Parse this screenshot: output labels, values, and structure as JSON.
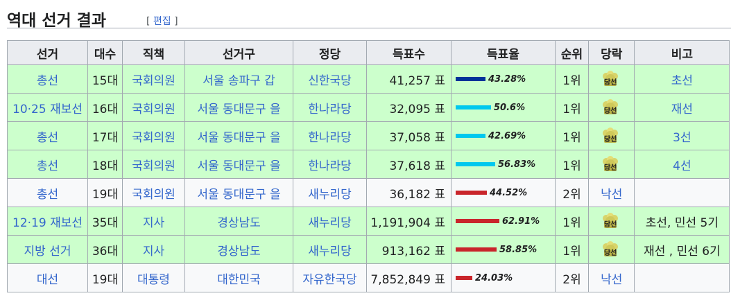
{
  "section": {
    "title": "역대 선거 결과",
    "edit_open": "[ ",
    "edit_label": "편집",
    "edit_close": " ]"
  },
  "table": {
    "headers": [
      "선거",
      "대수",
      "직책",
      "선거구",
      "정당",
      "득표수",
      "득표율",
      "순위",
      "당락",
      "비고"
    ],
    "rows": [
      {
        "election": "총선",
        "term": "15대",
        "position": "국회의원",
        "district": "서울 송파구 갑",
        "party": "신한국당",
        "votes": "41,257 표",
        "rate": "43.28%",
        "rate_value": 43.28,
        "bar_color": "#003399",
        "rank": "1위",
        "result": "당선",
        "result_badge": true,
        "note": "초선",
        "won": true
      },
      {
        "election": "10·25 재보선",
        "term": "16대",
        "position": "국회의원",
        "district": "서울 동대문구 을",
        "party": "한나라당",
        "votes": "32,095 표",
        "rate": "50.6%",
        "rate_value": 50.6,
        "bar_color": "#00c8ee",
        "rank": "1위",
        "result": "당선",
        "result_badge": true,
        "note": "재선",
        "won": true
      },
      {
        "election": "총선",
        "term": "17대",
        "position": "국회의원",
        "district": "서울 동대문구 을",
        "party": "한나라당",
        "votes": "37,058 표",
        "rate": "42.69%",
        "rate_value": 42.69,
        "bar_color": "#00c8ee",
        "rank": "1위",
        "result": "당선",
        "result_badge": true,
        "note": "3선",
        "won": true
      },
      {
        "election": "총선",
        "term": "18대",
        "position": "국회의원",
        "district": "서울 동대문구 을",
        "party": "한나라당",
        "votes": "37,618 표",
        "rate": "56.83%",
        "rate_value": 56.83,
        "bar_color": "#00c8ee",
        "rank": "1위",
        "result": "당선",
        "result_badge": true,
        "note": "4선",
        "won": true
      },
      {
        "election": "총선",
        "term": "19대",
        "position": "국회의원",
        "district": "서울 동대문구 을",
        "party": "새누리당",
        "votes": "36,182 표",
        "rate": "44.52%",
        "rate_value": 44.52,
        "bar_color": "#c9252b",
        "rank": "2위",
        "result": "낙선",
        "result_badge": false,
        "note": "",
        "won": false
      },
      {
        "election": "12·19 재보선",
        "term": "35대",
        "position": "지사",
        "district": "경상남도",
        "party": "새누리당",
        "votes": "1,191,904 표",
        "rate": "62.91%",
        "rate_value": 62.91,
        "bar_color": "#c9252b",
        "rank": "1위",
        "result": "당선",
        "result_badge": true,
        "note": "초선, 민선 5기",
        "won": true
      },
      {
        "election": "지방 선거",
        "term": "36대",
        "position": "지사",
        "district": "경상남도",
        "party": "새누리당",
        "votes": "913,162 표",
        "rate": "58.85%",
        "rate_value": 58.85,
        "bar_color": "#c9252b",
        "rank": "1위",
        "result": "당선",
        "result_badge": true,
        "note": "재선 , 민선 6기",
        "won": true
      },
      {
        "election": "대선",
        "term": "19대",
        "position": "대통령",
        "district": "대한민국",
        "party": "자유한국당",
        "votes": "7,852,849 표",
        "rate": "24.03%",
        "rate_value": 24.03,
        "bar_color": "#c9252b",
        "rank": "2위",
        "result": "낙선",
        "result_badge": false,
        "note": "",
        "won": false
      }
    ]
  },
  "colors": {
    "win_bg": "#ccffcc",
    "lose_bg": "#f8f9fa",
    "link": "#3366cc"
  }
}
